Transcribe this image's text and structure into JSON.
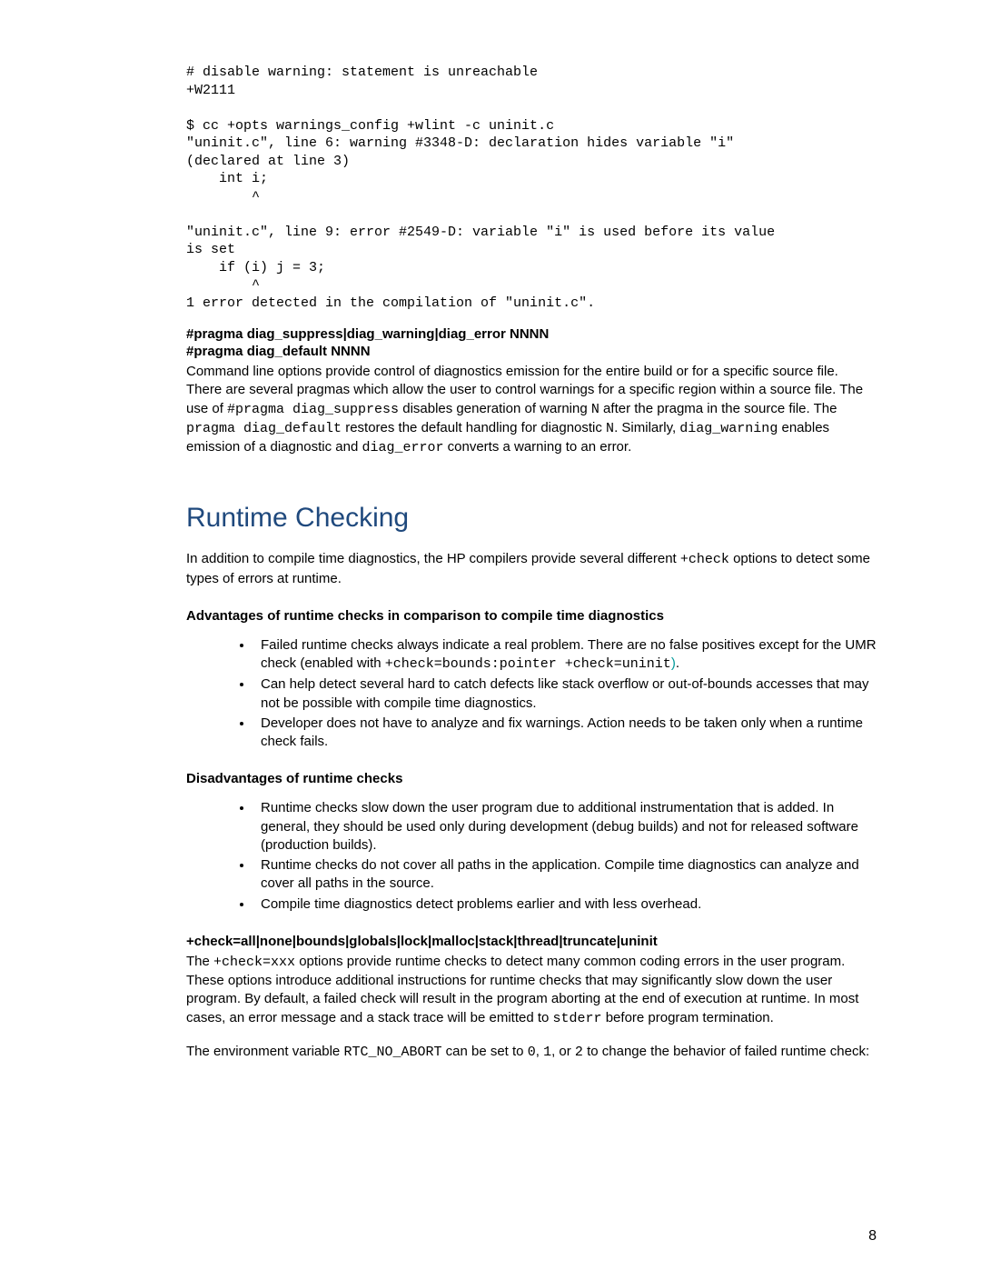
{
  "codeblock": "# disable warning: statement is unreachable\n+W2111\n\n$ cc +opts warnings_config +wlint -c uninit.c\n\"uninit.c\", line 6: warning #3348-D: declaration hides variable \"i\"\n(declared at line 3)\n    int i;\n        ^\n\n\"uninit.c\", line 9: error #2549-D: variable \"i\" is used before its value\nis set\n    if (i) j = 3;\n        ^\n1 error detected in the compilation of \"uninit.c\".",
  "pragma": {
    "heading1": "#pragma diag_suppress|diag_warning|diag_error NNNN",
    "heading2": "#pragma diag_default NNNN",
    "para_pre": "Command line options provide control of diagnostics emission for the entire build or for a specific source file.  There are several pragmas which allow the user to control warnings for a specific region within a source file.  The use of ",
    "code1": "#pragma diag_suppress",
    "para_mid1": " disables generation of warning ",
    "code2": "N",
    "para_mid2": " after the pragma in the source file. The ",
    "code3": "pragma diag_default",
    "para_mid3": " restores the default handling for diagnostic ",
    "code4": "N",
    "para_mid4": ". Similarly, ",
    "code5": "diag_warning",
    "para_mid5": " enables emission of a diagnostic and ",
    "code6": "diag_error",
    "para_end": " converts a warning to an error."
  },
  "runtime": {
    "title": "Runtime Checking",
    "intro_pre": "In addition to compile time diagnostics, the HP compilers provide several different ",
    "intro_code": "+check",
    "intro_post": " options to detect some types of errors at runtime.",
    "adv_heading": "Advantages of runtime checks in comparison to compile time diagnostics",
    "adv": {
      "b1_pre": "Failed runtime checks always indicate a real problem. There are no false positives except for the UMR check (enabled with ",
      "b1_code": "+check=bounds:pointer +check=uninit",
      "b1_paren": ")",
      "b1_post": ".",
      "b2": "Can help detect several hard to catch defects like stack overflow or out-of-bounds accesses that may not be possible with compile time diagnostics.",
      "b3": "Developer does not have to analyze and fix warnings. Action needs to be taken only when a runtime check fails."
    },
    "dis_heading": "Disadvantages of runtime checks",
    "dis": {
      "b1": "Runtime checks slow down the user program due to additional instrumentation that is added. In general, they should be used only during development (debug builds) and not for released software (production builds).",
      "b2": " Runtime checks do not cover all paths in the application. Compile time diagnostics can analyze and cover all paths in the source.",
      "b3": "Compile time diagnostics detect problems earlier and with less overhead."
    },
    "check_heading": "+check=all|none|bounds|globals|lock|malloc|stack|thread|truncate|uninit",
    "check_para_pre": "The ",
    "check_code1": "+check=xxx",
    "check_para_mid": " options provide runtime checks to detect many common coding errors in the user program. These options introduce additional instructions for runtime checks that may significantly slow down the user program.  By default, a failed check will result in the program aborting at the end of execution at runtime. In most cases, an error message and a stack trace will be emitted to ",
    "check_code2": "stderr",
    "check_para_end": " before program termination.",
    "env_pre": "The environment variable ",
    "env_code1": "RTC_NO_ABORT",
    "env_mid1": " can be set to ",
    "env_code2": "0",
    "env_mid2": ", ",
    "env_code3": "1",
    "env_mid3": ", or ",
    "env_code4": "2",
    "env_post": " to change the behavior of failed runtime check:"
  },
  "page_number": "8"
}
